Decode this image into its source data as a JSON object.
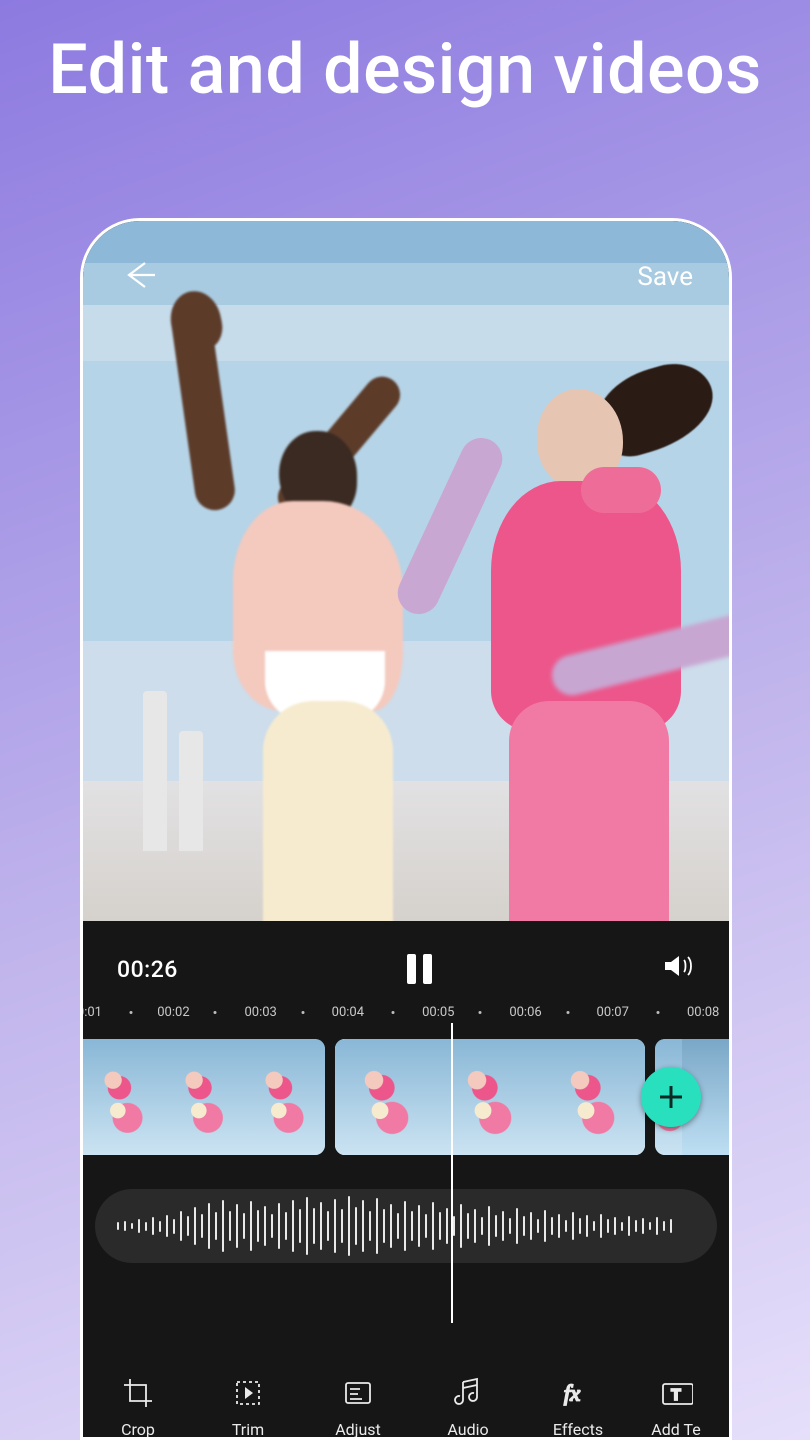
{
  "headline": "Edit and design videos",
  "topbar": {
    "save_label": "Save"
  },
  "transport": {
    "current_time": "00:26"
  },
  "ruler": {
    "labels": [
      "0:01",
      "00:02",
      "00:03",
      "00:04",
      "00:05",
      "00:06",
      "00:07",
      "00:08"
    ]
  },
  "tools": {
    "crop": "Crop",
    "trim": "Trim",
    "adjust": "Adjust",
    "audio": "Audio",
    "effects": "Effects",
    "addtext": "Add Te"
  },
  "icons": {
    "back": "back-arrow-icon",
    "pause": "pause-icon",
    "volume": "volume-icon",
    "add": "plus-icon"
  },
  "colors": {
    "accent": "#29e0be",
    "editor_bg": "#161616"
  }
}
